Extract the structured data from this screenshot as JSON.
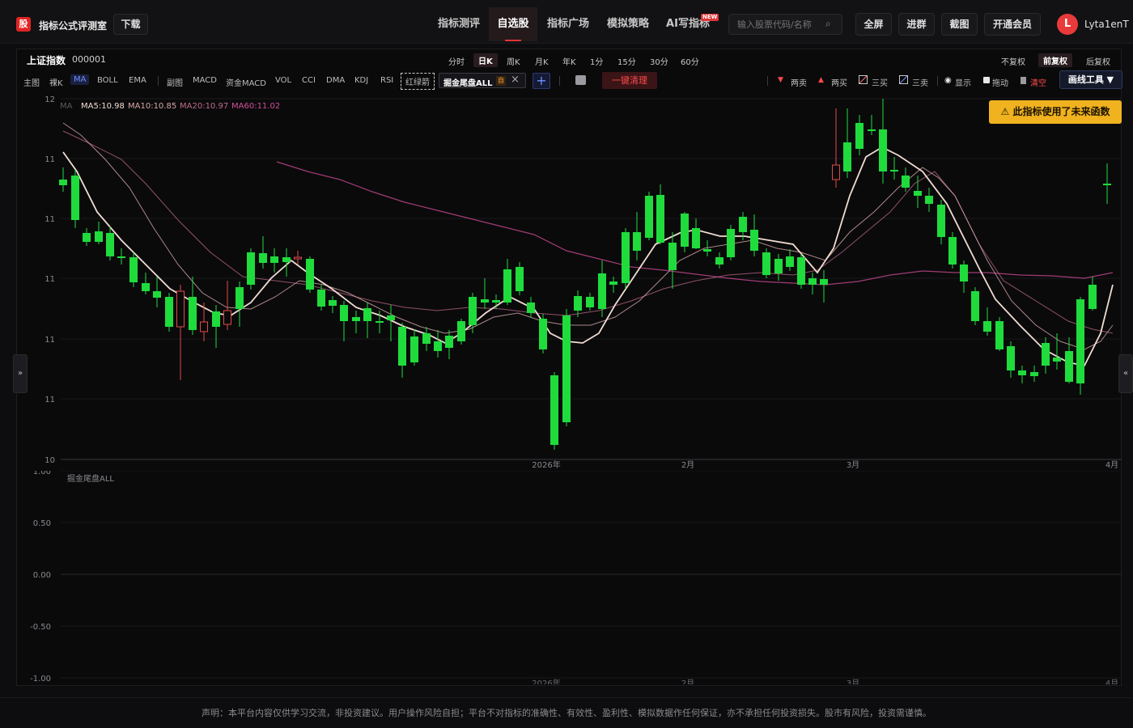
{
  "app": {
    "logo_char": "股",
    "title": "指标公式评测室",
    "download_label": "下载"
  },
  "nav": {
    "tabs": [
      {
        "label": "指标测评",
        "active": false
      },
      {
        "label": "自选股",
        "active": true
      },
      {
        "label": "指标广场",
        "active": false
      },
      {
        "label": "模拟策略",
        "active": false
      },
      {
        "label": "AI写指标",
        "active": false
      }
    ],
    "new_badge": "NEW",
    "search_placeholder": "输入股票代码/名称",
    "actions": [
      "全屏",
      "进群",
      "截图",
      "开通会员"
    ],
    "user_initial": "L",
    "username": "Lyta1enT"
  },
  "stock": {
    "name": "上证指数",
    "code": "000001"
  },
  "periods": {
    "items": [
      "分时",
      "日K",
      "周K",
      "月K",
      "年K",
      "1分",
      "15分",
      "30分",
      "60分"
    ],
    "active": "日K"
  },
  "adjust": {
    "items": [
      "不复权",
      "前复权",
      "后复权"
    ],
    "active": "前复权"
  },
  "indicator_bar": {
    "main_label": "主图",
    "main_items": [
      "裸K",
      "MA",
      "BOLL",
      "EMA"
    ],
    "main_active": "MA",
    "sub_label": "副图",
    "sub_items": [
      "MACD",
      "资金MACD",
      "VOL",
      "CCI",
      "DMA",
      "KDJ",
      "RSI"
    ],
    "dashed_item": "红绿箭",
    "custom_tag": "掘金尾盘ALL",
    "custom_tag_badge": "自",
    "clear_label": "一键清理"
  },
  "drawing": {
    "items": [
      {
        "label": "两卖",
        "icon": "down-triangle-icon"
      },
      {
        "label": "两买",
        "icon": "up-triangle-icon"
      },
      {
        "label": "三买",
        "icon": "line-icon"
      },
      {
        "label": "三卖",
        "icon": "line-icon"
      },
      {
        "label": "显示",
        "icon": "eye-icon"
      },
      {
        "label": "拖动",
        "icon": "lock-icon"
      },
      {
        "label": "清空",
        "icon": "trash-icon"
      }
    ],
    "tools_label": "画线工具"
  },
  "ma_legend": {
    "prefix": "MA",
    "items": [
      {
        "label": "MA5:10.98",
        "color": "#f2dcd2"
      },
      {
        "label": "MA10:10.85",
        "color": "#d8a7a7"
      },
      {
        "label": "MA20:10.97",
        "color": "#c06a8a"
      },
      {
        "label": "MA60:11.02",
        "color": "#d34d9a"
      }
    ]
  },
  "warning": "此指标使用了未来函数",
  "sub_chart_title": "掘金尾盘ALL",
  "disclaimer": "声明：本平台内容仅供学习交流，非投资建议。用户操作风险自担；平台不对指标的准确性、有效性、盈利性、模拟数据作任何保证，亦不承担任何投资损失。股市有风险，投资需谨慎。",
  "colors": {
    "up": "#e24a4a",
    "down": "#1fdc3c",
    "accent": "#e03535",
    "warning_bg": "#f0b21e"
  },
  "chart_data": {
    "type": "candlestick",
    "main_y_ticks": [
      "12",
      "11",
      "11",
      "11",
      "11",
      "11",
      "10"
    ],
    "x_ticks": [
      "2026年",
      "2月",
      "3月",
      "4月"
    ],
    "sub_y_ticks": [
      "1.00",
      "0.50",
      "0.00",
      "-0.50",
      "-1.00"
    ],
    "sub_ylim": [
      -1,
      1
    ],
    "ma_periods": [
      5,
      10,
      20,
      60
    ]
  }
}
